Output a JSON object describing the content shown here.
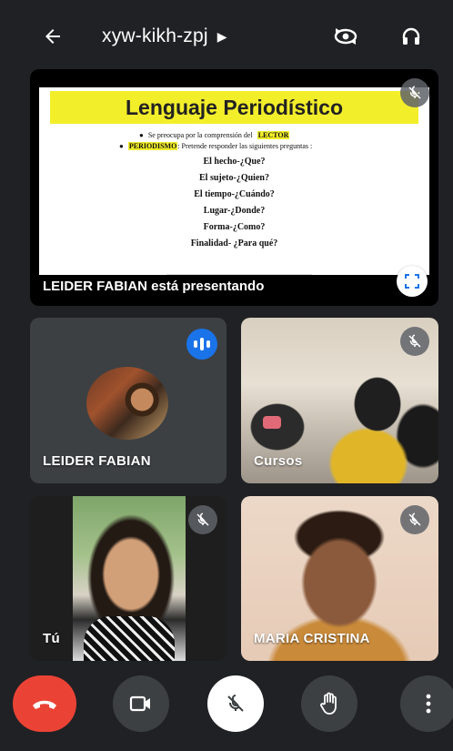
{
  "header": {
    "meeting_code": "xyw-kikh-zpj",
    "back_icon": "arrow-left-icon",
    "caret_icon": "caret-right-icon",
    "switch_camera_icon": "switch-camera-icon",
    "audio_icon": "headphones-icon"
  },
  "presentation": {
    "slide_title": "Lenguaje Periodístico",
    "bullet1_prefix": "Se preocupa por la comprensión del",
    "bullet1_highlight": "LECTOR",
    "bullet2_highlight": "PERIODISMO",
    "bullet2_text": ": Pretende responder las siguientes preguntas :",
    "questions": [
      "El hecho-¿Que?",
      "El sujeto-¿Quien?",
      "El tiempo-¿Cuándo?",
      "Lugar-¿Donde?",
      "Forma-¿Como?",
      "Finalidad- ¿Para qué?"
    ],
    "presenting_label": "LEIDER FABIAN está presentando",
    "highlight_color": "#f3ee2a"
  },
  "participants": {
    "leider": {
      "name": "LEIDER FABIAN",
      "speaking": true
    },
    "cursos": {
      "name": "Cursos",
      "muted": true
    },
    "tu": {
      "name": "Tú",
      "muted": true
    },
    "maria": {
      "name": "MARIA CRISTINA",
      "muted": true
    }
  },
  "controls": {
    "end_call_color": "#ea4335",
    "speaking_color": "#1a73e8",
    "icons": [
      "end-call-icon",
      "camera-icon",
      "mic-off-icon",
      "raise-hand-icon",
      "more-vert-icon"
    ]
  }
}
